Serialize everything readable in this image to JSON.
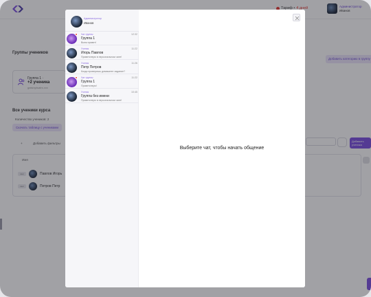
{
  "app": {
    "logo_icon": "brand-logo-icon",
    "trial": {
      "prefix": "Тариф • ",
      "days": "4 дней"
    },
    "user": {
      "role": "Администратор",
      "name": "Иванов"
    }
  },
  "background": {
    "groups_title": "Группы учеников",
    "group_chip_left": "",
    "group_chip_right": "Добавить категорию в группу",
    "group_card": {
      "line1": "Группа 1 ·",
      "line2": "+2 ученика",
      "line3": "gatsinptsatrs.xxx"
    },
    "all_students_title": "Все ученики курса",
    "students_count_label": "Количество учеников: 2",
    "export_button": "Скачать таблицу с учениками",
    "add_filters_button": "Добавить фильтры",
    "table_header_name": "Имя",
    "rows": [
      {
        "badge": "user",
        "name": "Павлов Игорь"
      },
      {
        "badge": "user",
        "name": "Петров Петр"
      }
    ],
    "purple_button": "Добавить ученика"
  },
  "chat_modal": {
    "current_user": {
      "role": "Администратор",
      "name": "Иванов"
    },
    "chats": [
      {
        "type": "Чат группы",
        "time": "12:32",
        "title": "Группа 1",
        "message": "Всем привет!",
        "avatar": "group",
        "unread": true
      },
      {
        "type": "Ученик",
        "time": "11:22",
        "title": "Игорь Павлов",
        "message": "Приветствую в персональном чате!",
        "avatar": "user",
        "unread": false
      },
      {
        "type": "Ученик",
        "time": "11:26",
        "title": "Петр Петров",
        "message": "Когда проверишь домашнее задание?",
        "avatar": "user",
        "unread": false
      },
      {
        "type": "Чат группы",
        "time": "11:22",
        "title": "Группа 1",
        "message": "Приветствую!",
        "avatar": "group",
        "unread": true
      },
      {
        "type": "Ученик",
        "time": "10:45",
        "title": "Группа без имени",
        "message": "Приветствую в персональном чате!",
        "avatar": "user",
        "unread": false
      }
    ],
    "empty_state": "Выберите чат, чтобы начать общение",
    "close_icon": "close-icon"
  }
}
